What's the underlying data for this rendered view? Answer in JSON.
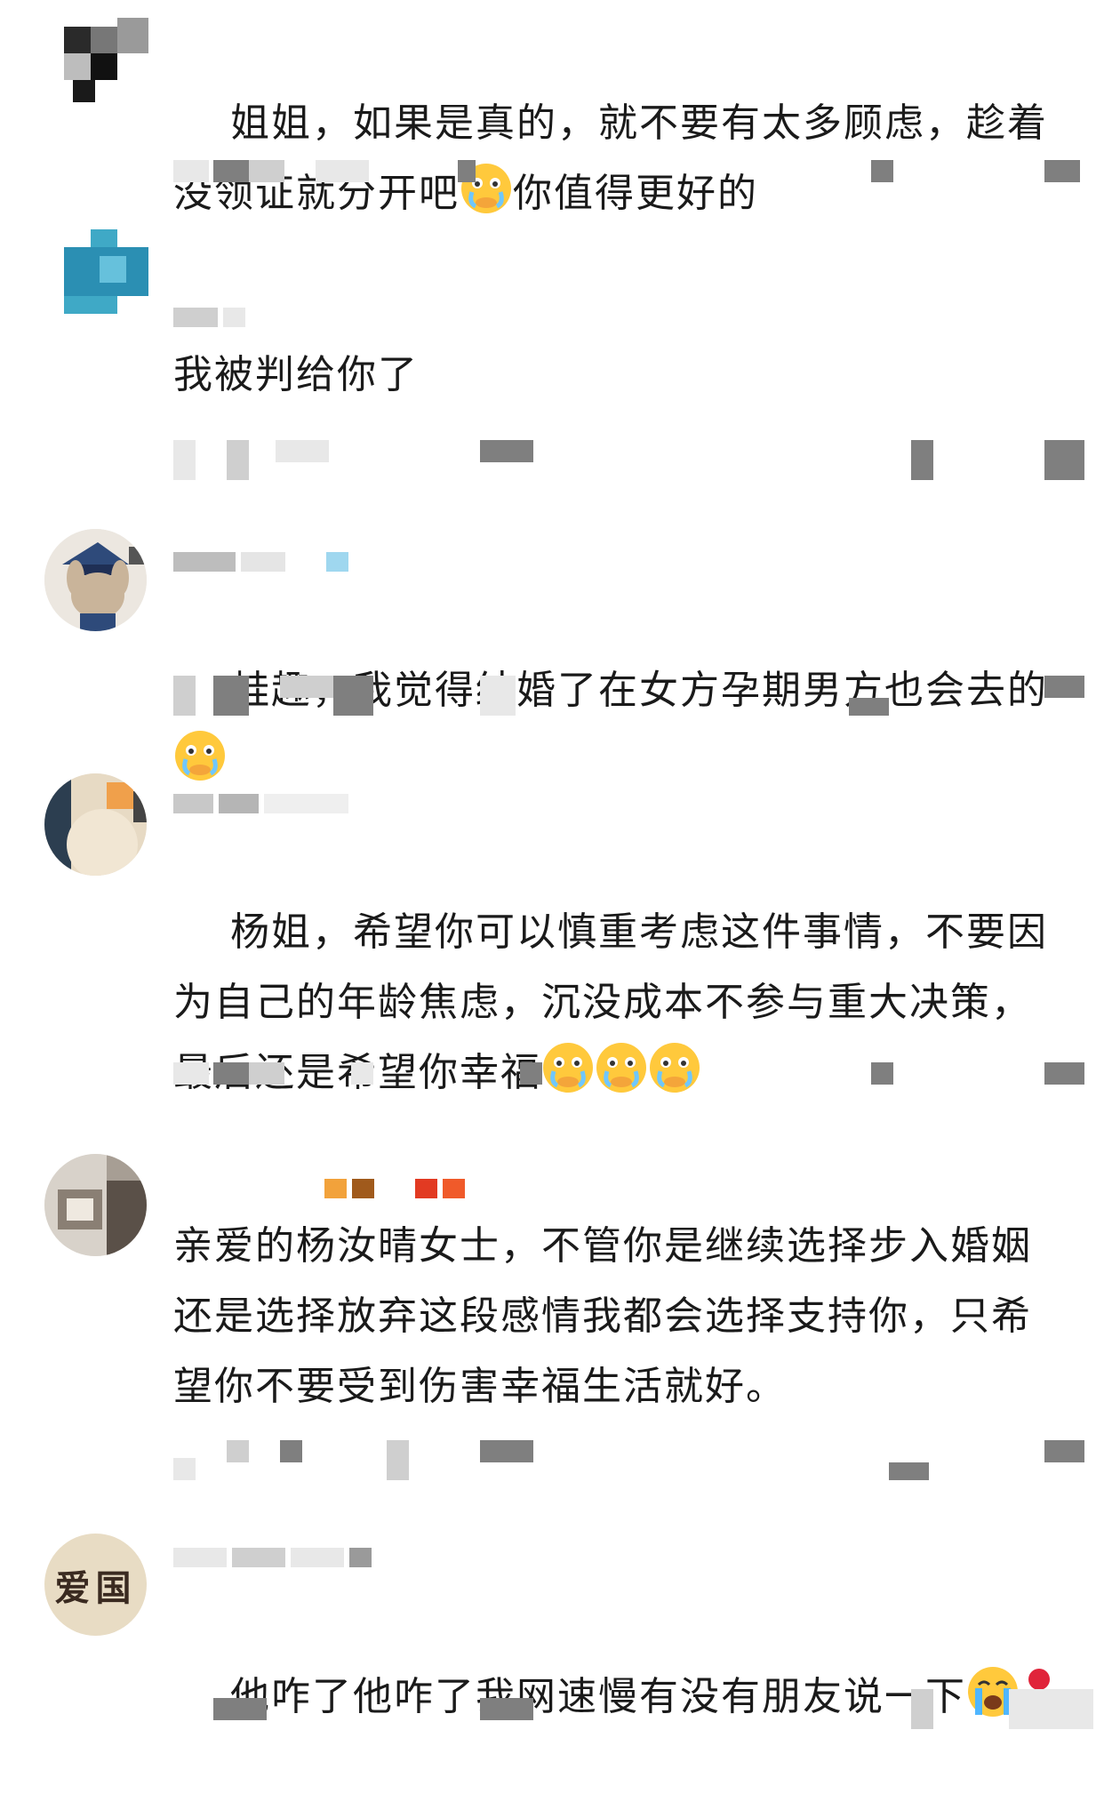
{
  "comments": [
    {
      "text": "姐姐，如果是真的，就不要有太多顾虑，趁着没领证就分开吧",
      "text_after_emoji": "你值得更好的"
    },
    {
      "text": "我被判给你了"
    },
    {
      "text": "蛙趣，我觉得结婚了在女方孕期男方也会去的"
    },
    {
      "text": "杨姐，希望你可以慎重考虑这件事情，不要因为自己的年龄焦虑，沉没成本不参与重大决策，最后还是希望你幸福"
    },
    {
      "text": "亲爱的杨汝晴女士，不管你是继续选择步入婚姻还是选择放弃这段感情我都会选择支持你，只希望你不要受到伤害幸福生活就好。"
    },
    {
      "text": "他咋了他咋了我网速慢有没有朋友说一下",
      "avatar_text": "爱国"
    }
  ],
  "icons": {
    "emoji": "crying-face-emoji",
    "sob": "loudly-crying-emoji",
    "rose": "rose-emoji"
  },
  "colors": {
    "text": "#1a1a1a",
    "emoji_yellow": "#ffc93c",
    "mosaic_gray": "#7f7f7f",
    "mosaic_light": "#e8e8e8"
  }
}
